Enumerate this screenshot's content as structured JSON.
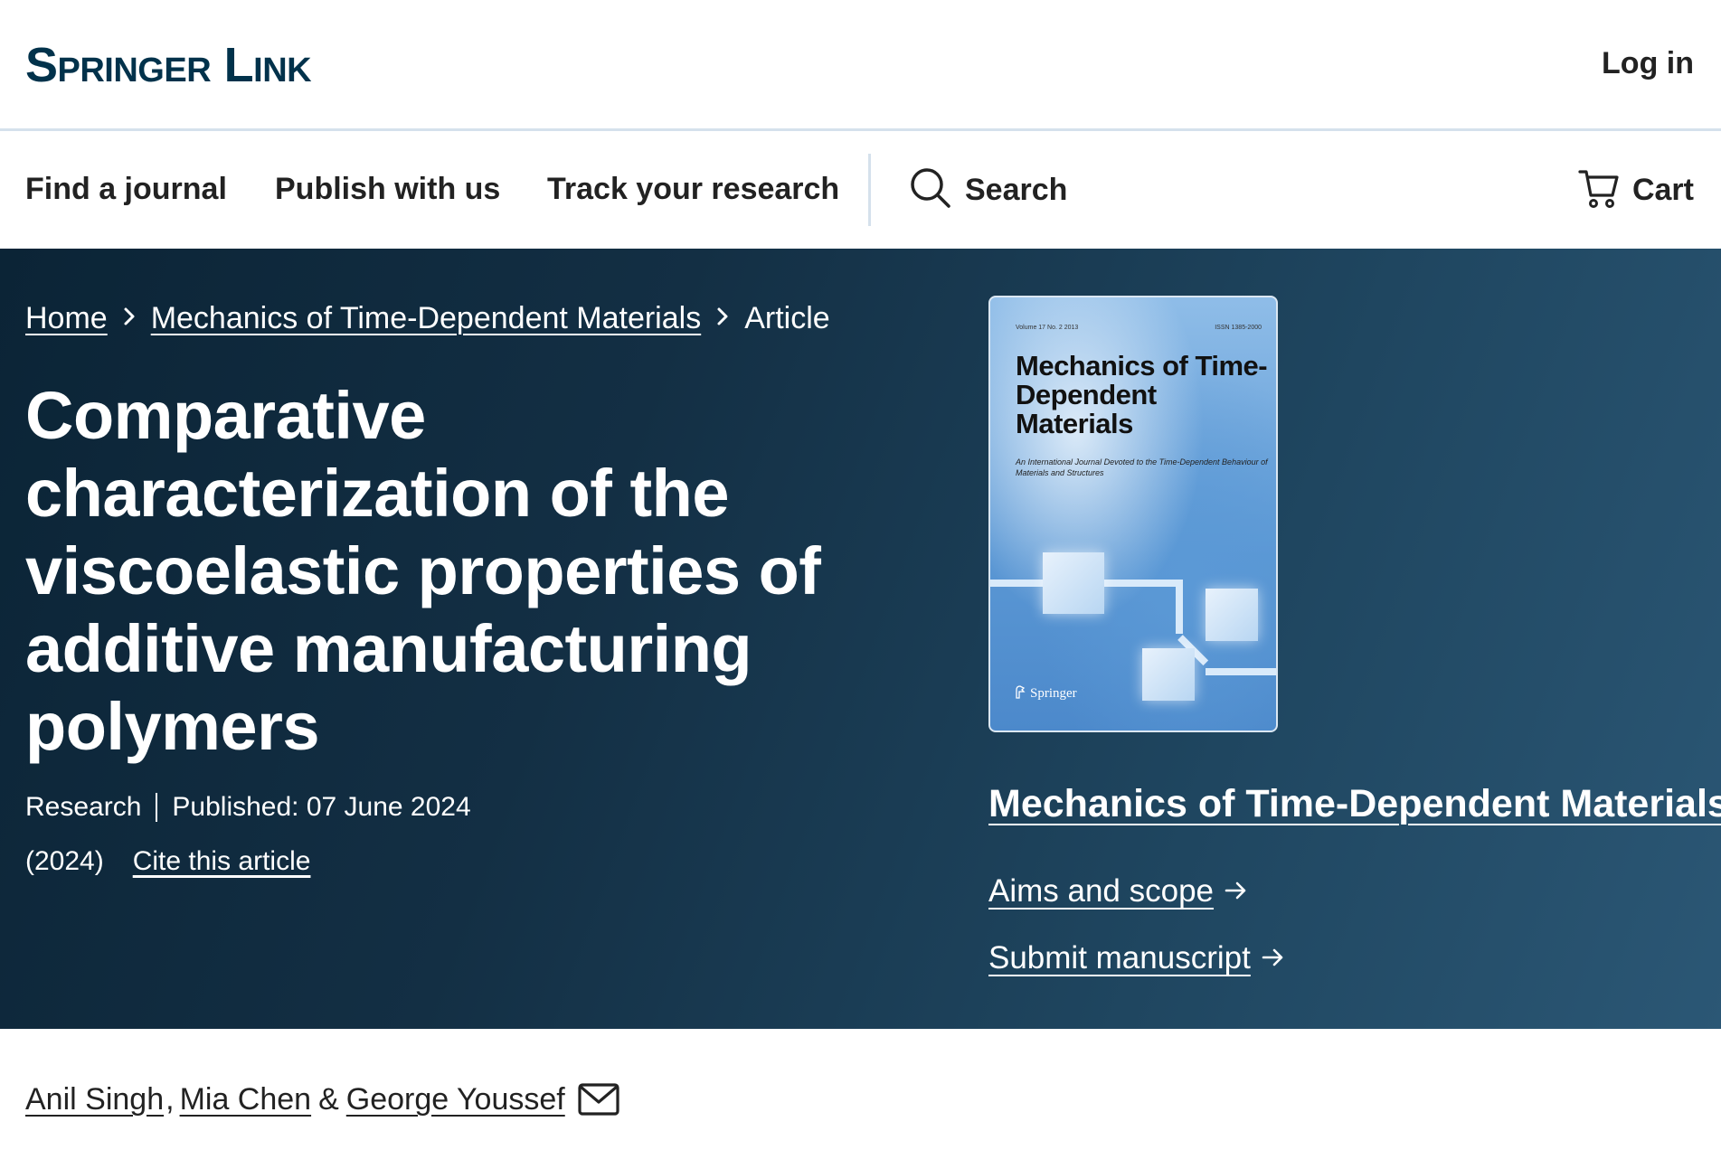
{
  "header": {
    "logo": "Springer Link",
    "login": "Log in"
  },
  "nav": {
    "items": [
      "Find a journal",
      "Publish with us",
      "Track your research"
    ],
    "search": "Search",
    "cart": "Cart"
  },
  "breadcrumb": {
    "home": "Home",
    "journal": "Mechanics of Time-Dependent Materials",
    "current": "Article"
  },
  "article": {
    "title": "Comparative characterization of the viscoelastic properties of additive manufacturing polymers",
    "type": "Research",
    "published": "Published: 07 June 2024",
    "year": "(2024)",
    "cite": "Cite this article"
  },
  "cover": {
    "volume": "Volume 17   No. 2   2013",
    "issn": "ISSN 1385-2000",
    "title": "Mechanics of Time-Dependent Materials",
    "subtitle": "An International Journal Devoted to the Time-Dependent Behaviour of Materials and Structures",
    "publisher": "Springer"
  },
  "journal": {
    "name": "Mechanics of Time-Dependent Materials",
    "aims": "Aims and scope",
    "submit": "Submit manuscript"
  },
  "authors": {
    "a1": "Anil Singh",
    "comma": ",",
    "a2": "Mia Chen",
    "amp": "&",
    "a3": "George Youssef"
  },
  "colors": {
    "brand": "#01324b",
    "hero_dark": "#0b2436",
    "hero_light": "#2b5775",
    "divider": "#d5e1ec"
  }
}
